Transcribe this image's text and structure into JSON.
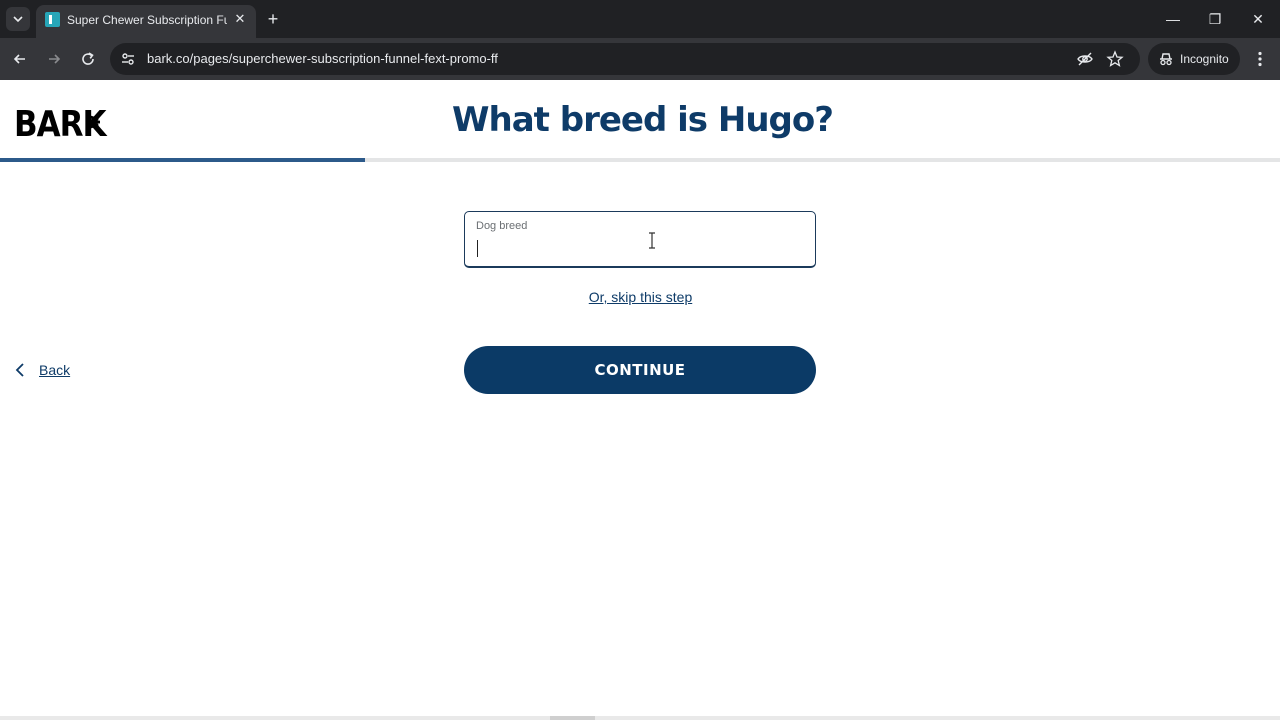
{
  "browser": {
    "tab_title": "Super Chewer Subscription Funnel",
    "tab_close": "✕",
    "new_tab": "+",
    "url": "bark.co/pages/superchewer-subscription-funnel-fext-promo-ff",
    "incognito_label": "Incognito",
    "window_controls": {
      "minimize": "—",
      "restore": "❐",
      "close": "✕"
    }
  },
  "page": {
    "logo_text": "BARK",
    "title": "What breed is Hugo?",
    "progress_percent": 28.5,
    "breed_field": {
      "label": "Dog breed",
      "value": "",
      "placeholder": ""
    },
    "skip_link": "Or, skip this step",
    "back_label": "Back",
    "continue_label": "CONTINUE"
  },
  "colors": {
    "brand_navy": "#0b3a66",
    "progress": "#2c5a8a",
    "chrome_dark": "#202124",
    "chrome_mid": "#35363a"
  },
  "icons": {
    "tab_list": "chevron-down-icon",
    "favicon": "bark-favicon-icon",
    "back_nav": "arrow-left-icon",
    "forward_nav": "arrow-right-icon",
    "reload": "reload-icon",
    "site_info": "tune-icon",
    "tracking": "eye-off-icon",
    "bookmark": "star-icon",
    "incognito": "incognito-icon",
    "menu": "more-vertical-icon",
    "page_back": "chevron-left-icon",
    "text_cursor": "ibeam-cursor-icon"
  }
}
